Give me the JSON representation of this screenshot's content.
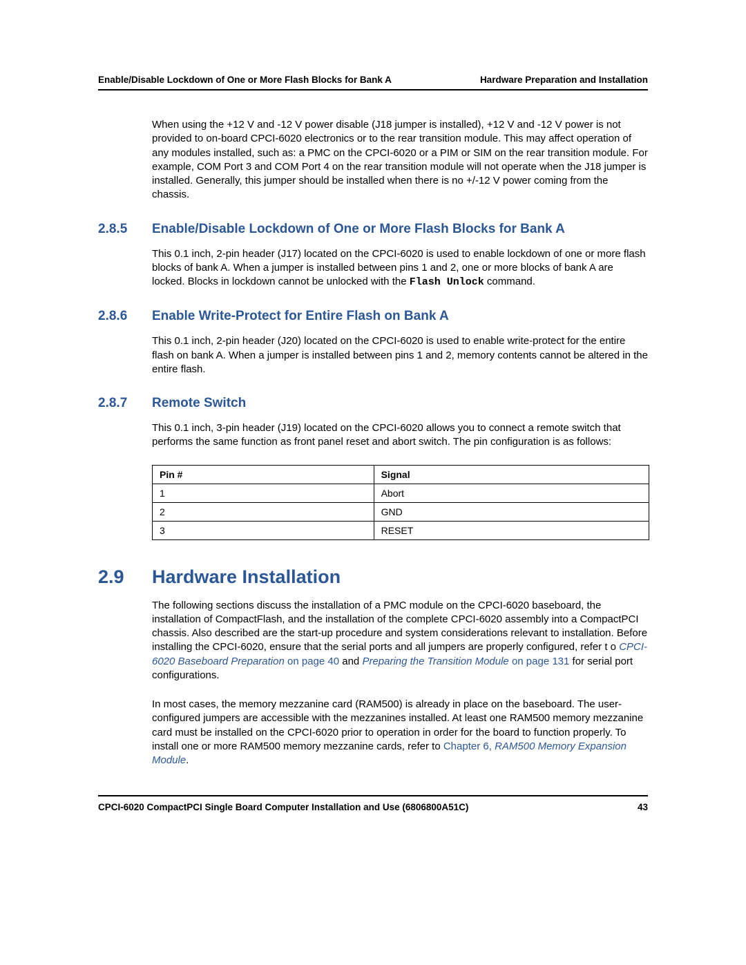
{
  "header": {
    "left": "Enable/Disable Lockdown of One or More Flash Blocks for Bank A",
    "right": "Hardware Preparation and Installation"
  },
  "intro_para": "When using the +12 V and -12 V power disable (J18 jumper is installed), +12 V and -12 V power is not provided to on-board CPCI-6020 electronics or to the rear transition module. This may affect operation of any modules installed, such as: a PMC on the CPCI-6020 or a PIM or SIM on the rear transition module. For example, COM Port 3 and COM Port 4 on the rear transition module will not operate when the J18 jumper is installed. Generally, this jumper should be installed when there is no +/-12 V power coming from the chassis.",
  "s285": {
    "num": "2.8.5",
    "title": "Enable/Disable Lockdown of One or More Flash Blocks for Bank A",
    "body_pre": "This 0.1 inch, 2-pin header (J17) located on the CPCI-6020 is used to enable lockdown of one or more flash blocks of bank A. When a jumper is installed between pins 1 and 2, one or more blocks of bank A are locked. Blocks in lockdown cannot be unlocked with the ",
    "code": "Flash Unlock",
    "body_post": " command."
  },
  "s286": {
    "num": "2.8.6",
    "title": "Enable Write-Protect for Entire Flash on Bank A",
    "body": "This 0.1 inch, 2-pin header (J20) located on the CPCI-6020 is used to enable write-protect for the entire flash on bank A. When a jumper is installed between pins 1 and 2, memory contents cannot be altered in the entire flash."
  },
  "s287": {
    "num": "2.8.7",
    "title": "Remote Switch",
    "body": "This 0.1 inch, 3-pin header (J19) located on the CPCI-6020 allows you to connect a remote switch that performs the same function as front panel reset and abort switch. The pin configuration is as follows:",
    "table": {
      "h1": "Pin #",
      "h2": "Signal",
      "rows": [
        {
          "c1": "1",
          "c2": "Abort"
        },
        {
          "c1": "2",
          "c2": "GND"
        },
        {
          "c1": "3",
          "c2": "RESET"
        }
      ]
    }
  },
  "s29": {
    "num": "2.9",
    "title": "Hardware Installation",
    "p1_a": "The following sections discuss the installation of a PMC module on the CPCI-6020 baseboard, the installation of CompactFlash, and the installation of the complete CPCI-6020 assembly into a CompactPCI chassis. Also described are the start-up procedure and system considerations relevant to installation. Before installing the CPCI-6020, ensure that the serial ports and all jumpers are properly configured, refer t o ",
    "link1_italic": "CPCI-6020 Baseboard Preparation",
    "link1_plain": " on page 40",
    "p1_b": " and ",
    "link2_italic": "Preparing the Transition Module",
    "link2_plain": " on page 131",
    "p1_c": " for serial port configurations.",
    "p2_a": "In most cases, the memory mezzanine card (RAM500) is already in place on the baseboard. The user-configured jumpers are accessible with the mezzanines installed. At least one RAM500 memory mezzanine card must be installed on the CPCI-6020 prior to operation in order for the board to function properly. To install one or more RAM500 memory mezzanine cards, refer to ",
    "link3_plain": "Chapter 6, ",
    "link3_italic": "RAM500 Memory Expansion Module",
    "p2_b": "."
  },
  "footer": {
    "left": "CPCI-6020 CompactPCI Single Board Computer Installation and Use (6806800A51C)",
    "right": "43"
  }
}
